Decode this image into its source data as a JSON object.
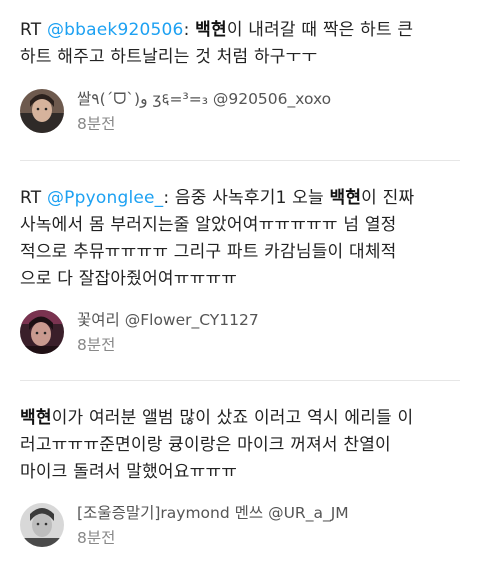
{
  "tweets": [
    {
      "lines": [
        [
          {
            "t": "RT "
          },
          {
            "t": "@bbaek920506",
            "c": "mention"
          },
          {
            "t": ": "
          },
          {
            "t": "백현",
            "c": "kw"
          },
          {
            "t": "이 내려갈 때 짝은 하트 큰"
          }
        ],
        [
          {
            "t": "하트 해주고 하트날리는 것 처럼 하구ㅜㅜ"
          }
        ]
      ],
      "author_name": "쌀٩(ˊᗜˋ)و ʒ६=³=₃",
      "author_handle": "@920506_xoxo",
      "time": "8분전"
    },
    {
      "lines": [
        [
          {
            "t": "RT "
          },
          {
            "t": "@Ppyonglee_",
            "c": "mention"
          },
          {
            "t": ": 음중 사녹후기1 오늘 "
          },
          {
            "t": "백현",
            "c": "kw"
          },
          {
            "t": "이 진짜"
          }
        ],
        [
          {
            "t": "사녹에서 몸 부러지는줄 알았어여ㅠㅠㅠㅠㅠ 넘 열정"
          }
        ],
        [
          {
            "t": "적으로 추뮤ㅠㅠㅠㅠ 그리구 파트 카감님들이 대체적"
          }
        ],
        [
          {
            "t": "으로 다 잘잡아줬어여ㅠㅠㅠㅠ"
          }
        ]
      ],
      "author_name": "꽃여리",
      "author_handle": "@Flower_CY1127",
      "time": "8분전"
    },
    {
      "lines": [
        [
          {
            "t": "백현",
            "c": "kw"
          },
          {
            "t": "이가 여러분 앨범 많이 샀죠 이러고 역시 에리들 이"
          }
        ],
        [
          {
            "t": "러고ㅠㅠㅠ준면이랑 큥이랑은 마이크 꺼져서 찬열이"
          }
        ],
        [
          {
            "t": "마이크 돌려서 말했어요ㅠㅠㅠ"
          }
        ]
      ],
      "author_name": "[조울증말기]raymond 멘쓰",
      "author_handle": "@UR_a_JM",
      "time": "8분전"
    }
  ]
}
